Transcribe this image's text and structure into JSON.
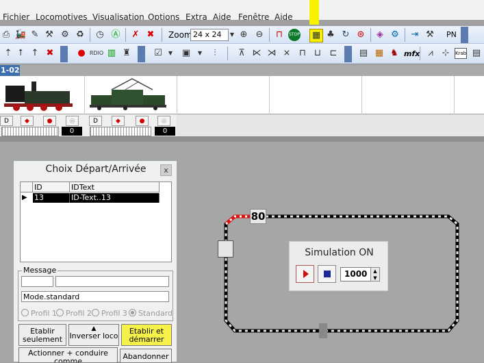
{
  "menu": [
    "Fichier",
    "Locomotives",
    "Visualisation",
    "Options",
    "Extra",
    "Aide",
    "Fenêtre",
    "Aide"
  ],
  "toolbar1": {
    "zoom_label": "Zoom",
    "zoom_value": "24 x 24",
    "pn_label": "PN"
  },
  "toolbar2": {
    "mfx_label": "mfx",
    "krab_label": "Krab"
  },
  "tab": {
    "label": "1-02"
  },
  "locos": [
    {
      "name": "steam-locomotive",
      "count": "0"
    },
    {
      "name": "electric-locomotive",
      "count": "0"
    }
  ],
  "dialog": {
    "title": "Choix Départ/Arrivée",
    "close": "x",
    "columns": [
      "ID",
      "IDText"
    ],
    "rows": [
      {
        "id": "13",
        "idtext": "ID-Text..13"
      }
    ],
    "message_label": "Message",
    "mode_text": "Mode.standard",
    "radios": [
      "Profil 1",
      "Profil 2",
      "Profil 3",
      "Standard"
    ],
    "btn_establish_only": "Etablir seulement",
    "btn_reverse_loco": "Inverser loco",
    "btn_establish_start": "Etablir et démarrer",
    "btn_actuate": "Actionner + conduire comme",
    "btn_abandon": "Abandonner"
  },
  "simulation": {
    "title": "Simulation ON",
    "value": "1000"
  },
  "track": {
    "speed_tag": "80"
  },
  "colors": {
    "highlight": "#f6f200",
    "tab": "#3b6fb0",
    "track_active": "#e01010",
    "start_button": "#f7f24a"
  }
}
